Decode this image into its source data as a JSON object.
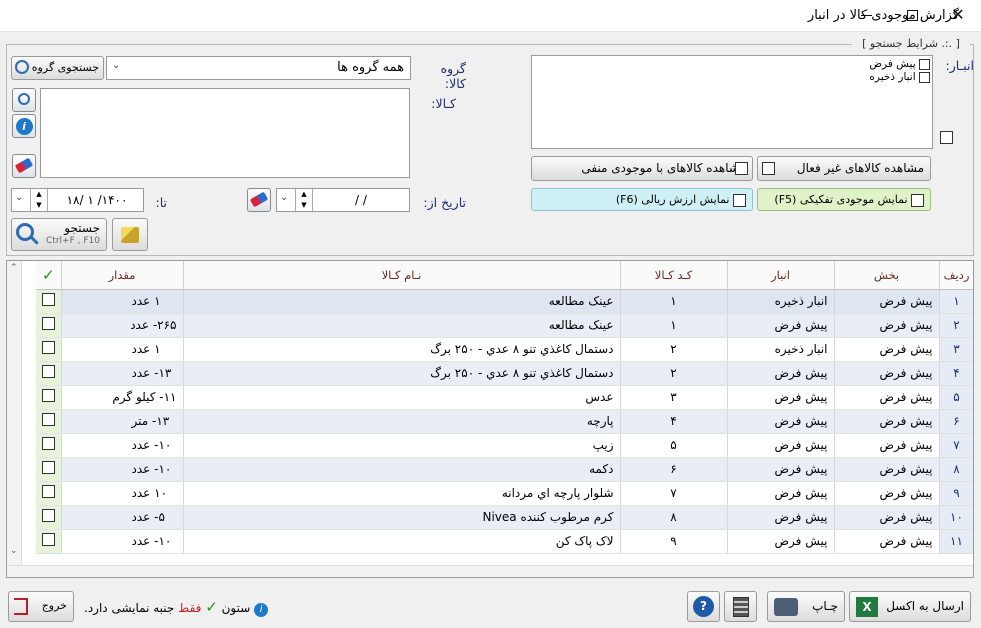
{
  "window": {
    "title": "گزارش موجودی کالا در انبار",
    "maximize": "☐",
    "close": "✕",
    "minimize": "—"
  },
  "search_group": {
    "title": "[ .:. شرايط جستجو ]"
  },
  "warehouse": {
    "label": "انبـار:",
    "items": [
      {
        "label": "پیش فرض"
      },
      {
        "label": "انبار ذخيره"
      }
    ]
  },
  "product_group": {
    "label": "گروه کالا:",
    "selected": "همه گروه ها",
    "search_button": "جستجوی گروه"
  },
  "product": {
    "label": "کـالا:"
  },
  "date": {
    "from_label": "تاریخ از:",
    "from_value": "/      /",
    "to_label": "تا:",
    "to_value": "۱۴۰۰/ ۱ /۱۸"
  },
  "options": {
    "inactive": "مشاهده کالاهای غیر فعال",
    "negative": "مشاهده کالاهای با موجودی منفی",
    "separate": "نمایش موجودی تفکیکی (F5)",
    "rial_value": "نمایش ارزش ریالی  (F6)"
  },
  "search_button": {
    "label": "جستجو",
    "shortcut": "Ctrl+F , F10"
  },
  "grid": {
    "headers": {
      "row": "رديف",
      "section": "بخش",
      "warehouse": "انبار",
      "code": "کـد کـالا",
      "name": "نـام کـالا",
      "quantity": "مقدار",
      "check": "✓"
    },
    "rows": [
      {
        "n": "۱",
        "section": "پیش فرض",
        "wh": "انبار ذخيره",
        "code": "۱",
        "name": "عينک مطالعه",
        "qty": "۱ عدد"
      },
      {
        "n": "۲",
        "section": "پیش فرض",
        "wh": "پیش فرض",
        "code": "۱",
        "name": "عينک مطالعه",
        "qty": "۲۶۵- عدد"
      },
      {
        "n": "۳",
        "section": "پیش فرض",
        "wh": "انبار ذخيره",
        "code": "۲",
        "name": "دستمال کاغذي تنو ۸ عدي - ۲۵۰ برگ",
        "qty": "۱ عدد"
      },
      {
        "n": "۴",
        "section": "پیش فرض",
        "wh": "پیش فرض",
        "code": "۲",
        "name": "دستمال کاغذي تنو ۸ عدي - ۲۵۰ برگ",
        "qty": "۱۳- عدد"
      },
      {
        "n": "۵",
        "section": "پیش فرض",
        "wh": "پیش فرض",
        "code": "۳",
        "name": "عدس",
        "qty": "۱۱- کيلو گرم"
      },
      {
        "n": "۶",
        "section": "پیش فرض",
        "wh": "پیش فرض",
        "code": "۴",
        "name": "پارچه",
        "qty": "۱۳- متر"
      },
      {
        "n": "۷",
        "section": "پیش فرض",
        "wh": "پیش فرض",
        "code": "۵",
        "name": "زيپ",
        "qty": "۱۰- عدد"
      },
      {
        "n": "۸",
        "section": "پیش فرض",
        "wh": "پیش فرض",
        "code": "۶",
        "name": "دکمه",
        "qty": "۱۰- عدد"
      },
      {
        "n": "۹",
        "section": "پیش فرض",
        "wh": "پیش فرض",
        "code": "۷",
        "name": "شلوار پارچه اي مردانه",
        "qty": "۱۰ عدد"
      },
      {
        "n": "۱۰",
        "section": "پیش فرض",
        "wh": "پیش فرض",
        "code": "۸",
        "name": "کرم مرطوب کننده Nivea",
        "qty": "۵- عدد"
      },
      {
        "n": "۱۱",
        "section": "پیش فرض",
        "wh": "پیش فرض",
        "code": "۹",
        "name": "لاک پاک کن",
        "qty": "۱۰- عدد"
      }
    ]
  },
  "footer": {
    "excel": "ارسال به اکسل",
    "print": "چـاپ",
    "exit": "خروج",
    "note_prefix": "ستون",
    "note_red": "فقط",
    "note_suffix": "جنبه نمایشی دارد."
  },
  "colors": {
    "accent_navy": "#1d2f6f",
    "header_text": "#6a2a22",
    "green_check": "#2e8b1e",
    "red": "#cc1f1f"
  }
}
